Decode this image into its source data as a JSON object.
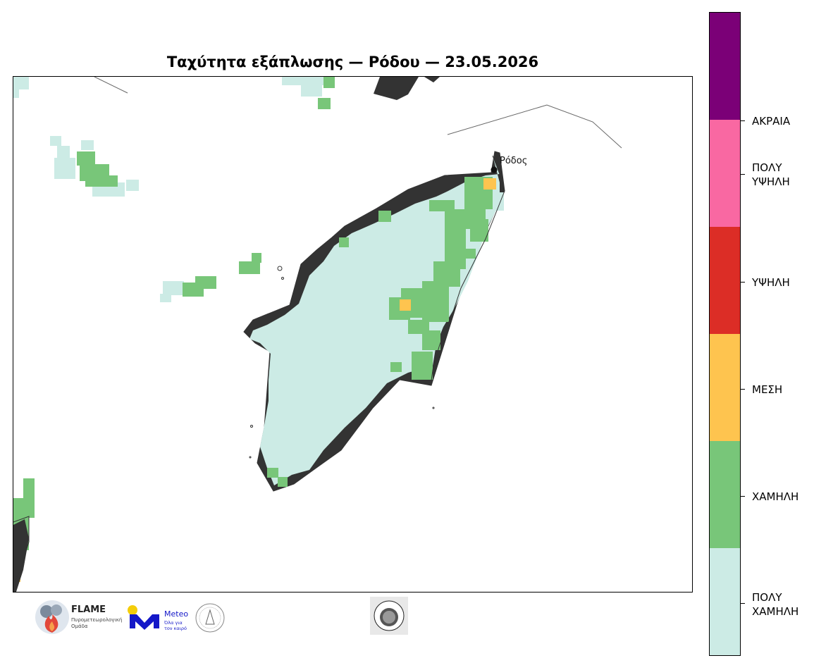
{
  "title": "Ταχύτητα εξάπλωσης — Ρόδου — 23.05.2026",
  "place_label": "Ρόδος",
  "legend": {
    "categories": [
      {
        "label": "ΑΚΡΑΙΑ",
        "color": "#7b0077"
      },
      {
        "label": "ΠΟΛΥ\nΥΨΗΛΗ",
        "color": "#f968a2"
      },
      {
        "label": "ΥΨΗΛΗ",
        "color": "#dc2d26"
      },
      {
        "label": "ΜΕΣΗ",
        "color": "#fec44f"
      },
      {
        "label": "ΧΑΜΗΛΗ",
        "color": "#78c679"
      },
      {
        "label": "ΠΟΛΥ\nΧΑΜΗΛΗ",
        "color": "#ccebe5"
      }
    ]
  },
  "colors": {
    "land_nodata": "#333333",
    "coastline": "#333333",
    "boundary": "#666666"
  },
  "logos": {
    "flame_title": "FLAME",
    "flame_subtitle": "Πυρομετεωρολογική\nΟμάδα",
    "meteo_title": "Meteo",
    "meteo_subtitle": "Όλα για\nτον καιρό"
  }
}
